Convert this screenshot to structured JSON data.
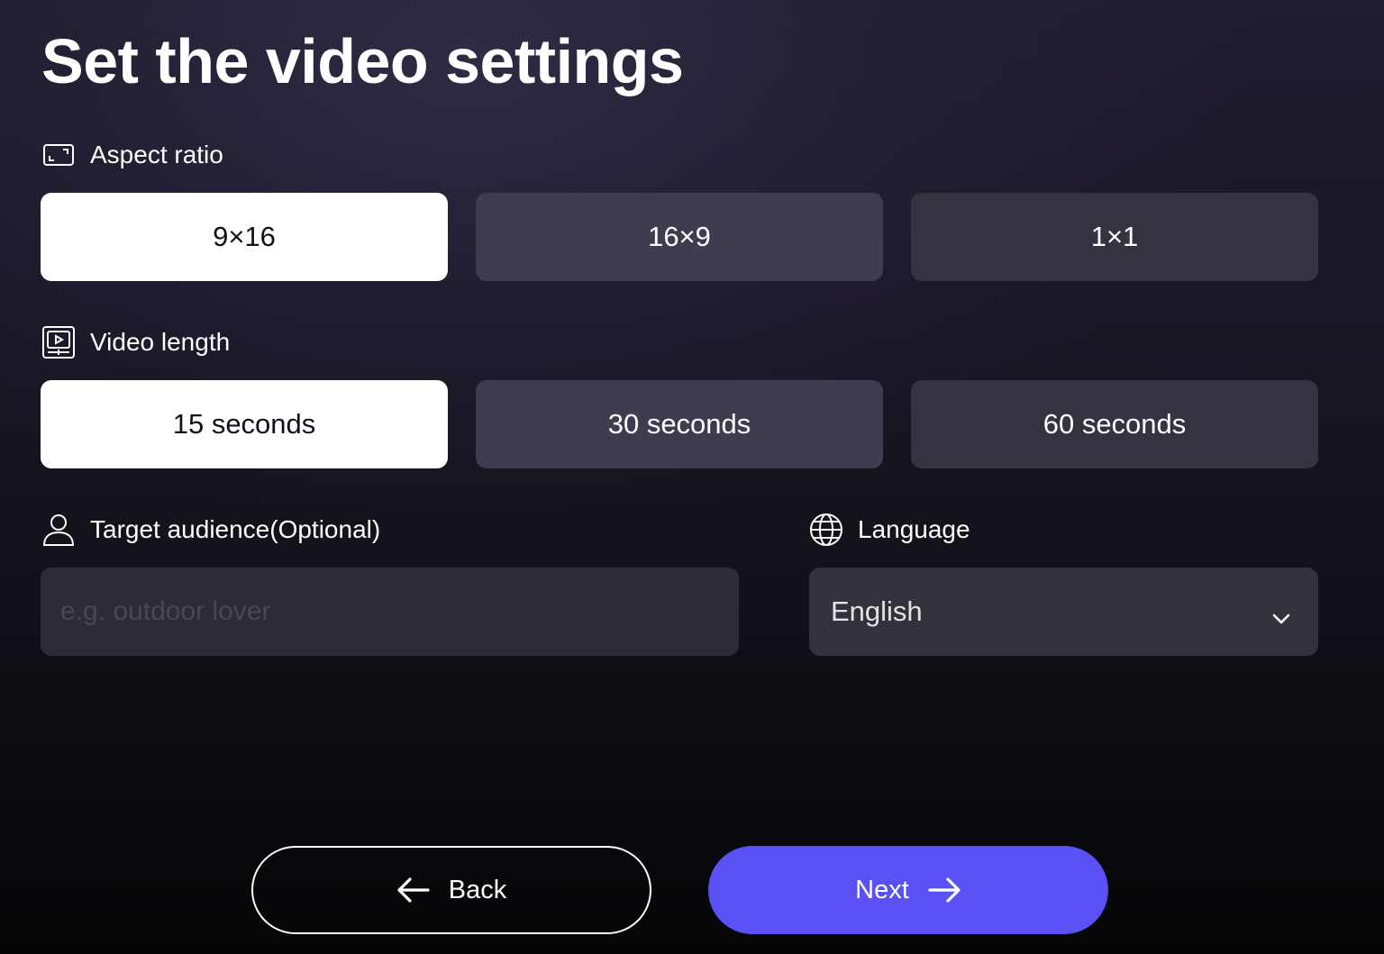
{
  "title": "Set the video settings",
  "aspect_ratio": {
    "label": "Aspect ratio",
    "icon": "aspect-ratio-icon",
    "options": [
      "9×16",
      "16×9",
      "1×1"
    ],
    "selected": "9×16"
  },
  "video_length": {
    "label": "Video length",
    "icon": "video-icon",
    "options": [
      "15 seconds",
      "30 seconds",
      "60 seconds"
    ],
    "selected": "15 seconds"
  },
  "audience": {
    "label": "Target audience(Optional)",
    "icon": "user-icon",
    "placeholder": "e.g. outdoor lover",
    "value": ""
  },
  "language": {
    "label": "Language",
    "icon": "globe-icon",
    "value": "English"
  },
  "buttons": {
    "back": "Back",
    "next": "Next"
  },
  "colors": {
    "accent": "#5a50f5",
    "selected_bg": "#ffffff"
  }
}
